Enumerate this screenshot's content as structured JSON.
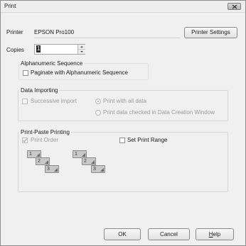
{
  "window": {
    "title": "Print"
  },
  "printer": {
    "label": "Printer",
    "value": "EPSON Pro100",
    "settings_button": "Printer Settings"
  },
  "copies": {
    "label": "Copies",
    "value": "1"
  },
  "alphanumeric": {
    "title": "Alphanumeric Sequence",
    "paginate_label": "Paginate with Alphanumeric Sequence"
  },
  "data_importing": {
    "title": "Data Importing",
    "successive_label": "Successive import",
    "radio_all_label": "Print with all data",
    "radio_checked_label": "Print data checked in Data Creation Window"
  },
  "print_paste": {
    "title": "Print-Paste Printing",
    "print_order_label": "Print Order",
    "set_range_label": "Set Print Range",
    "sheet_numbers": [
      "1",
      "2",
      "3"
    ]
  },
  "buttons": {
    "ok": "OK",
    "cancel": "Cancel",
    "help": "Help",
    "help_mnemonic": "H",
    "help_rest": "elp"
  }
}
